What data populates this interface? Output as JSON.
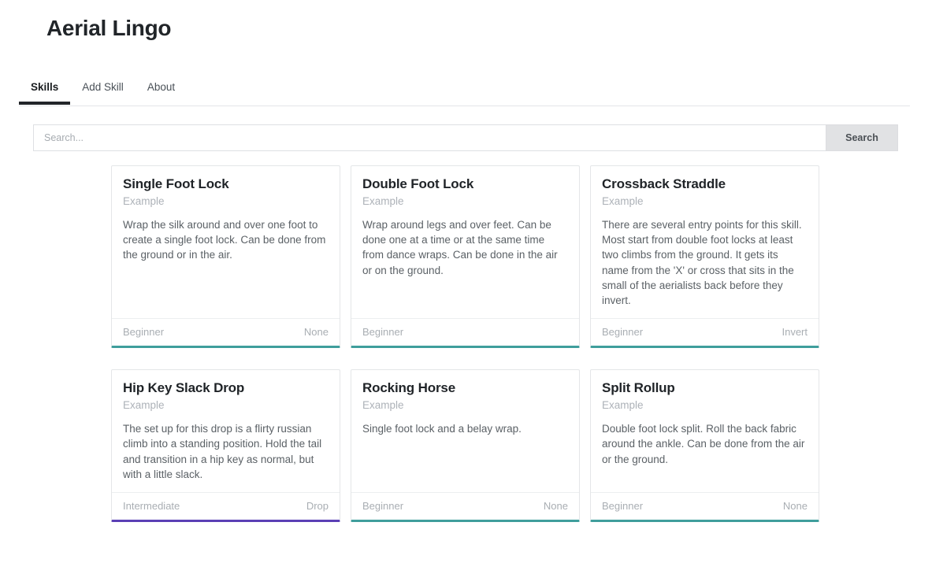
{
  "header": {
    "title": "Aerial Lingo"
  },
  "tabs": [
    {
      "label": "Skills",
      "active": true
    },
    {
      "label": "Add Skill",
      "active": false
    },
    {
      "label": "About",
      "active": false
    }
  ],
  "search": {
    "value": "",
    "placeholder": "Search...",
    "button_label": "Search"
  },
  "colors": {
    "beginner_accent": "#3f9e9c",
    "intermediate_accent": "#5b3fb5",
    "tab_active_underline": "#222529",
    "search_button_bg": "#e1e2e4",
    "card_border": "#e4e6e8",
    "muted_text": "#a9aeb3"
  },
  "rows": [
    {
      "name": "row-1",
      "cards": [
        {
          "title": "Single Foot Lock",
          "subtitle": "Example",
          "description": "Wrap the silk around and over one foot to create a single foot lock. Can be done from the ground or in the air.",
          "level": "Beginner",
          "family": "None",
          "accent": "#3f9e9c"
        },
        {
          "title": "Double Foot Lock",
          "subtitle": "Example",
          "description": "Wrap around legs and over feet. Can be done one at a time or at the same time from dance wraps. Can be done in the air or on the ground.",
          "level": "Beginner",
          "family": "",
          "accent": "#3f9e9c"
        },
        {
          "title": "Crossback Straddle",
          "subtitle": "Example",
          "description": "There are several entry points for this skill. Most start from double foot locks at least two climbs from the ground. It gets its name from the 'X' or cross that sits in the small of the aerialists back before they invert.",
          "level": "Beginner",
          "family": "Invert",
          "accent": "#3f9e9c"
        }
      ]
    },
    {
      "name": "row-2",
      "cards": [
        {
          "title": "Hip Key Slack Drop",
          "subtitle": "Example",
          "description": "The set up for this drop is a flirty russian climb into a standing position. Hold the tail and transition in a hip key as normal, but with a little slack.",
          "level": "Intermediate",
          "family": "Drop",
          "accent": "#5b3fb5"
        },
        {
          "title": "Rocking Horse",
          "subtitle": "Example",
          "description": "Single foot lock and a belay wrap.",
          "level": "Beginner",
          "family": "None",
          "accent": "#3f9e9c"
        },
        {
          "title": "Split Rollup",
          "subtitle": "Example",
          "description": "Double foot lock split. Roll the back fabric around the ankle. Can be done from the air or the ground.",
          "level": "Beginner",
          "family": "None",
          "accent": "#3f9e9c"
        }
      ]
    }
  ]
}
